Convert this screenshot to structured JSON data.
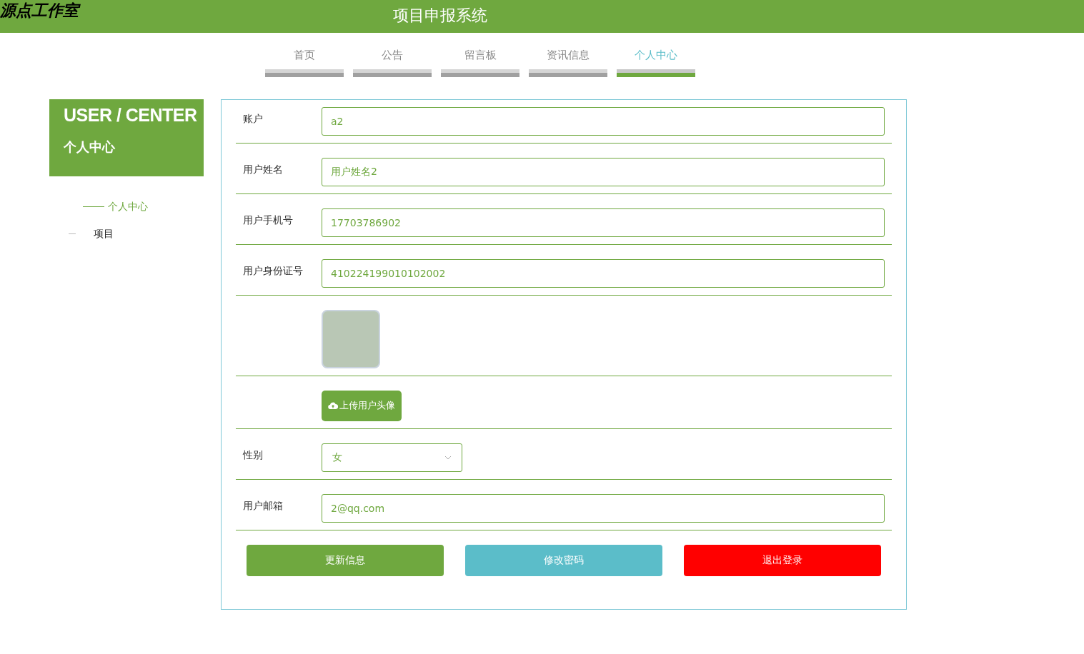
{
  "header": {
    "logo": "源点工作室",
    "title": "项目申报系统"
  },
  "nav": [
    {
      "label": "首页",
      "selected": false
    },
    {
      "label": "公告",
      "selected": false
    },
    {
      "label": "留言板",
      "selected": false
    },
    {
      "label": "资讯信息",
      "selected": false
    },
    {
      "label": "个人中心",
      "selected": true
    }
  ],
  "sidebar": {
    "title_en": "USER / CENTER",
    "title_cn": "个人中心",
    "items": [
      {
        "label": "个人中心",
        "selected": true
      },
      {
        "label": "项目",
        "selected": false
      }
    ]
  },
  "form": {
    "rows": [
      {
        "kind": "input",
        "label": "账户",
        "value": "a2"
      },
      {
        "kind": "input",
        "label": "用户姓名",
        "value": "用户姓名2"
      },
      {
        "kind": "input",
        "label": "用户手机号",
        "value": "17703786902"
      },
      {
        "kind": "input",
        "label": "用户身份证号",
        "value": "410224199010102002"
      },
      {
        "kind": "avatar"
      },
      {
        "kind": "upload",
        "button": "上传用户头像"
      },
      {
        "kind": "select",
        "label": "性别",
        "value": "女"
      },
      {
        "kind": "input",
        "label": "用户邮箱",
        "value": "2@qq.com"
      }
    ],
    "buttons": [
      {
        "label": "更新信息",
        "color": "#6fa83f"
      },
      {
        "label": "修改密码",
        "color": "#5bbdc9"
      },
      {
        "label": "退出登录",
        "color": "#ff0000"
      }
    ]
  }
}
